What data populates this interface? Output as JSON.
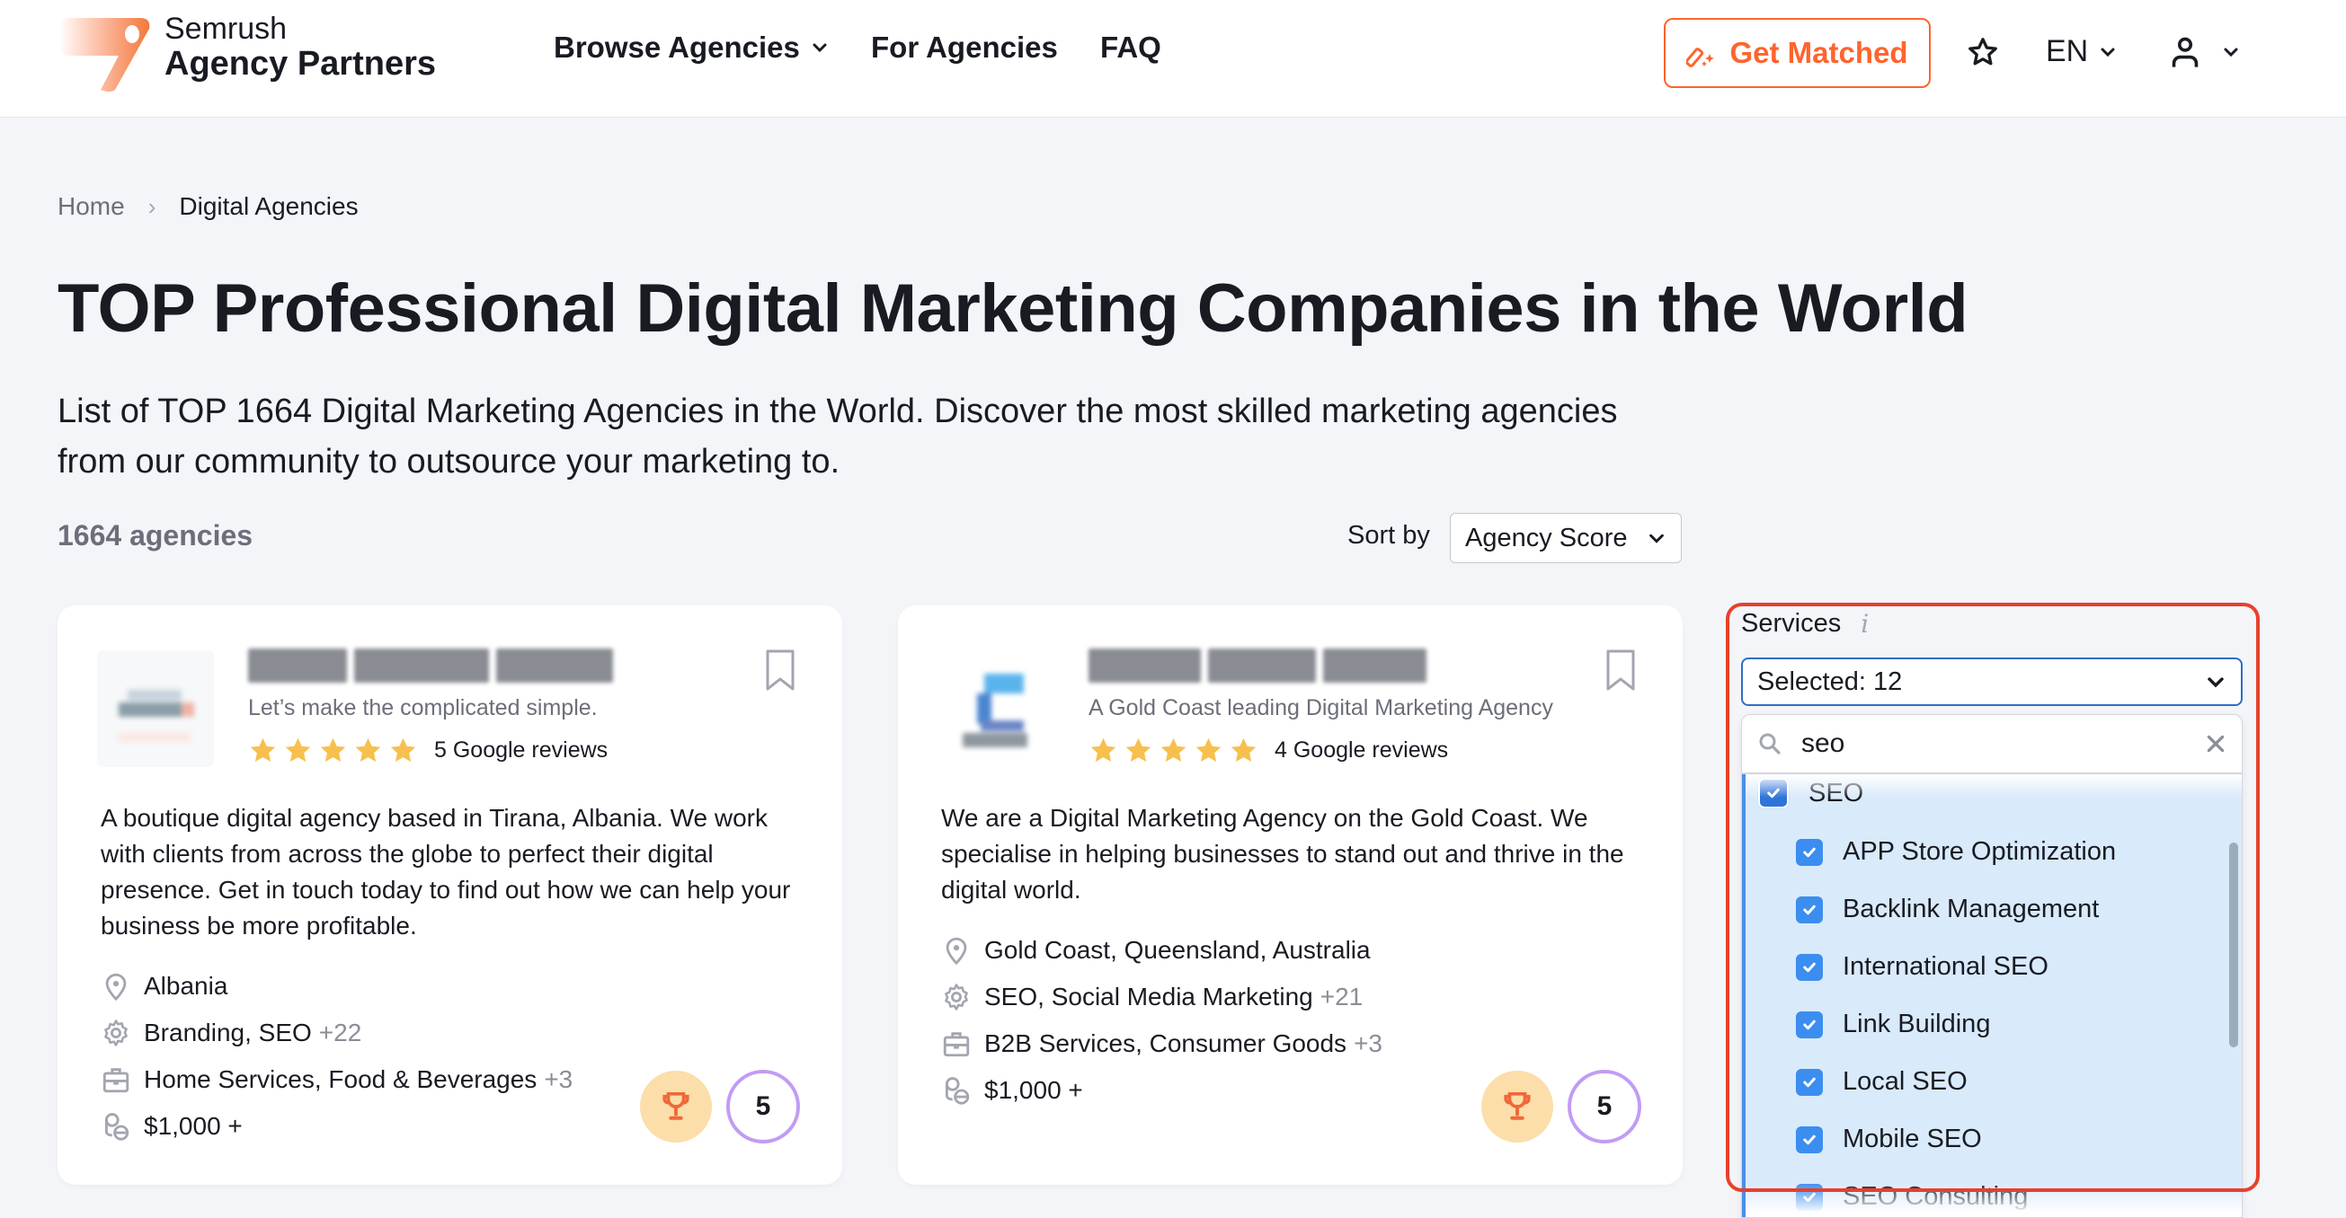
{
  "header": {
    "logo_line1": "Semrush",
    "logo_line2": "Agency Partners",
    "nav": [
      {
        "label": "Browse Agencies",
        "has_dropdown": true
      },
      {
        "label": "For Agencies",
        "has_dropdown": false
      },
      {
        "label": "FAQ",
        "has_dropdown": false
      }
    ],
    "get_matched_label": "Get Matched",
    "language": "EN",
    "icons": {
      "favorites": "star-icon",
      "account": "user-icon",
      "get_matched": "magic-wand-icon"
    }
  },
  "breadcrumb": {
    "home": "Home",
    "separator": "›",
    "current": "Digital Agencies"
  },
  "page": {
    "title": "TOP Professional Digital Marketing Companies in the World",
    "description": "List of TOP 1664 Digital Marketing Agencies in the World. Discover the most skilled marketing agencies from our community to outsource your marketing to.",
    "count_label": "1664 agencies",
    "sort_label": "Sort by",
    "sort_value": "Agency Score"
  },
  "agencies": [
    {
      "name": "[blurred]",
      "tagline": "Let’s make the complicated simple.",
      "stars": 5,
      "reviews": "5 Google reviews",
      "description": "A boutique digital agency based in Tirana, Albania. We work with clients from across the globe to perfect their digital presence. Get in touch today to find out how we can help your business be more profitable.",
      "location": "Albania",
      "services": "Branding, SEO",
      "services_more": "+22",
      "industries": "Home Services, Food & Beverages",
      "industries_more": "+3",
      "budget": "$1,000 +",
      "score": "5"
    },
    {
      "name": "[blurred]",
      "tagline": "A Gold Coast leading Digital Marketing Agency",
      "stars": 5,
      "reviews": "4 Google reviews",
      "description": "We are a Digital Marketing Agency on the Gold Coast. We specialise in helping businesses to stand out and thrive in the digital world.",
      "location": "Gold Coast, Queensland, Australia",
      "services": "SEO, Social Media Marketing",
      "services_more": "+21",
      "industries": "B2B Services, Consumer Goods",
      "industries_more": "+3",
      "budget": "$1,000 +",
      "score": "5"
    }
  ],
  "services_filter": {
    "label": "Services",
    "info_icon": "i",
    "selected_label": "Selected: 12",
    "search_value": "seo",
    "options": [
      {
        "label": "SEO",
        "checked": true,
        "level": 0
      },
      {
        "label": "APP Store Optimization",
        "checked": true,
        "level": 1
      },
      {
        "label": "Backlink Management",
        "checked": true,
        "level": 1
      },
      {
        "label": "International SEO",
        "checked": true,
        "level": 1
      },
      {
        "label": "Link Building",
        "checked": true,
        "level": 1
      },
      {
        "label": "Local SEO",
        "checked": true,
        "level": 1
      },
      {
        "label": "Mobile SEO",
        "checked": true,
        "level": 1
      },
      {
        "label": "SEO Consulting",
        "checked": true,
        "level": 1
      }
    ]
  },
  "colors": {
    "brand_orange": "#ff642d",
    "highlight_red": "#e8402a",
    "checkbox_blue": "#3b8ef0",
    "selected_bg": "#d9eafb",
    "star_yellow": "#f7c04e",
    "score_ring": "#c29bf5",
    "trophy_bg": "#fbdea9"
  }
}
